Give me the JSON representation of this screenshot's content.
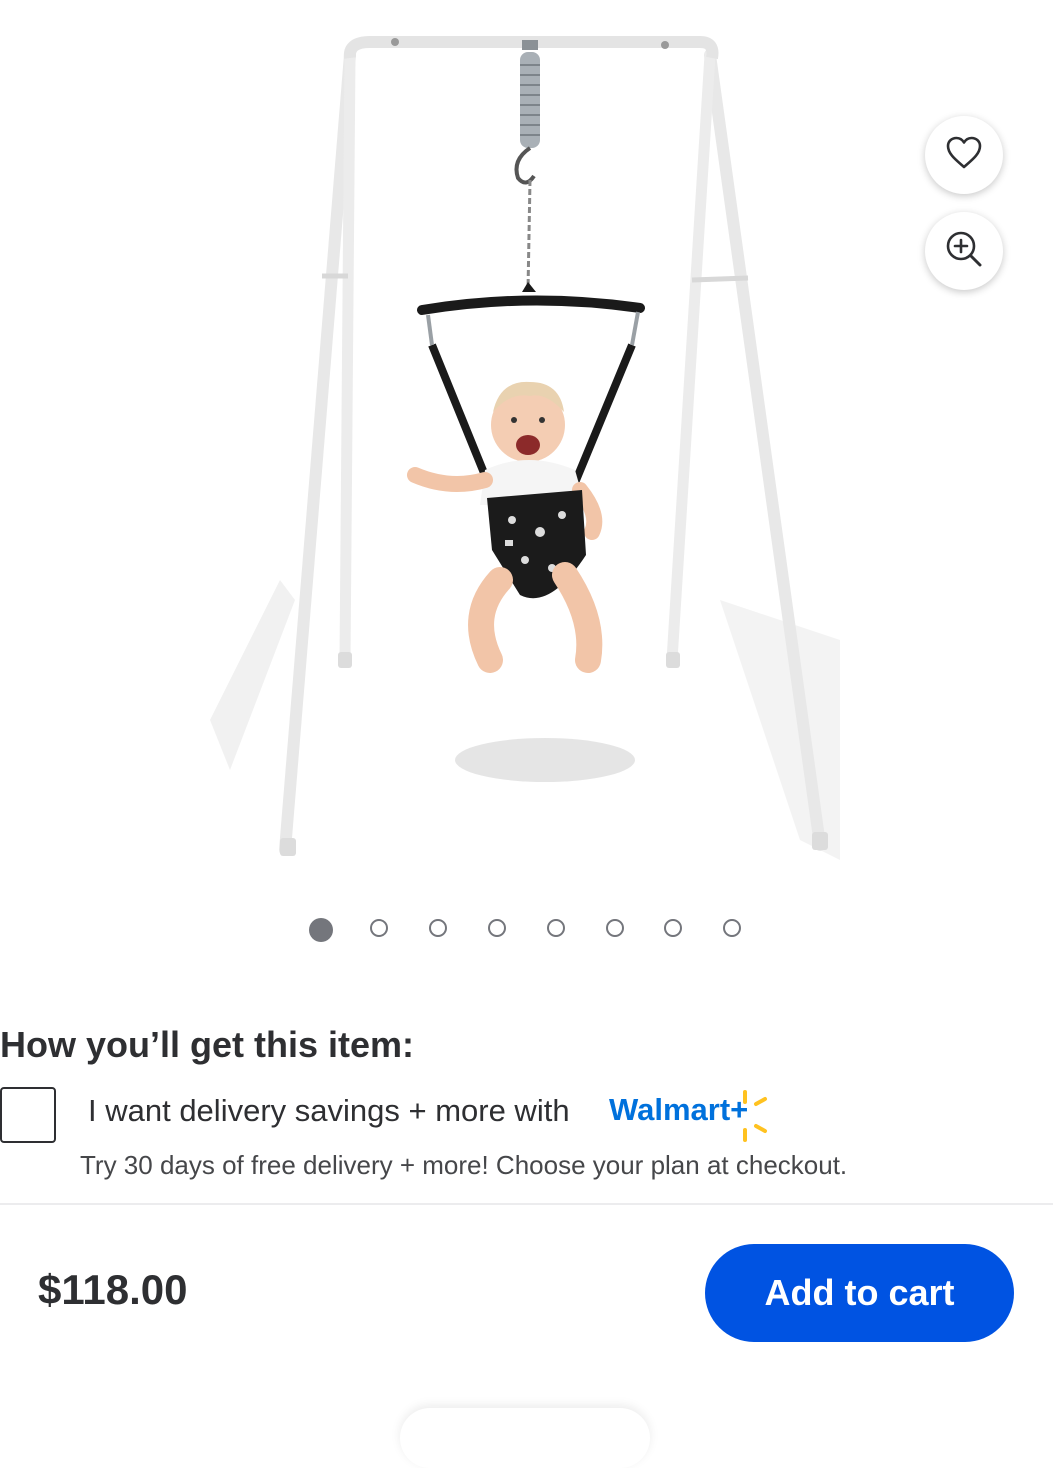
{
  "product": {
    "image_alt": "Baby jumper on white stand",
    "gallery_count": 8,
    "active_index": 0
  },
  "actions": {
    "favorite_icon": "heart-icon",
    "zoom_icon": "zoom-in-icon"
  },
  "delivery": {
    "title": "How you’ll get this item:",
    "offer_text": "I want delivery savings + more with",
    "brand": "Walmart+",
    "subtext": "Try 30 days of free delivery + more! Choose your plan at checkout."
  },
  "purchase": {
    "price": "$118.00",
    "cart_label": "Add to cart"
  },
  "colors": {
    "accent": "#0053e2",
    "brand_blue": "#0071dc",
    "spark_yellow": "#ffc220"
  }
}
